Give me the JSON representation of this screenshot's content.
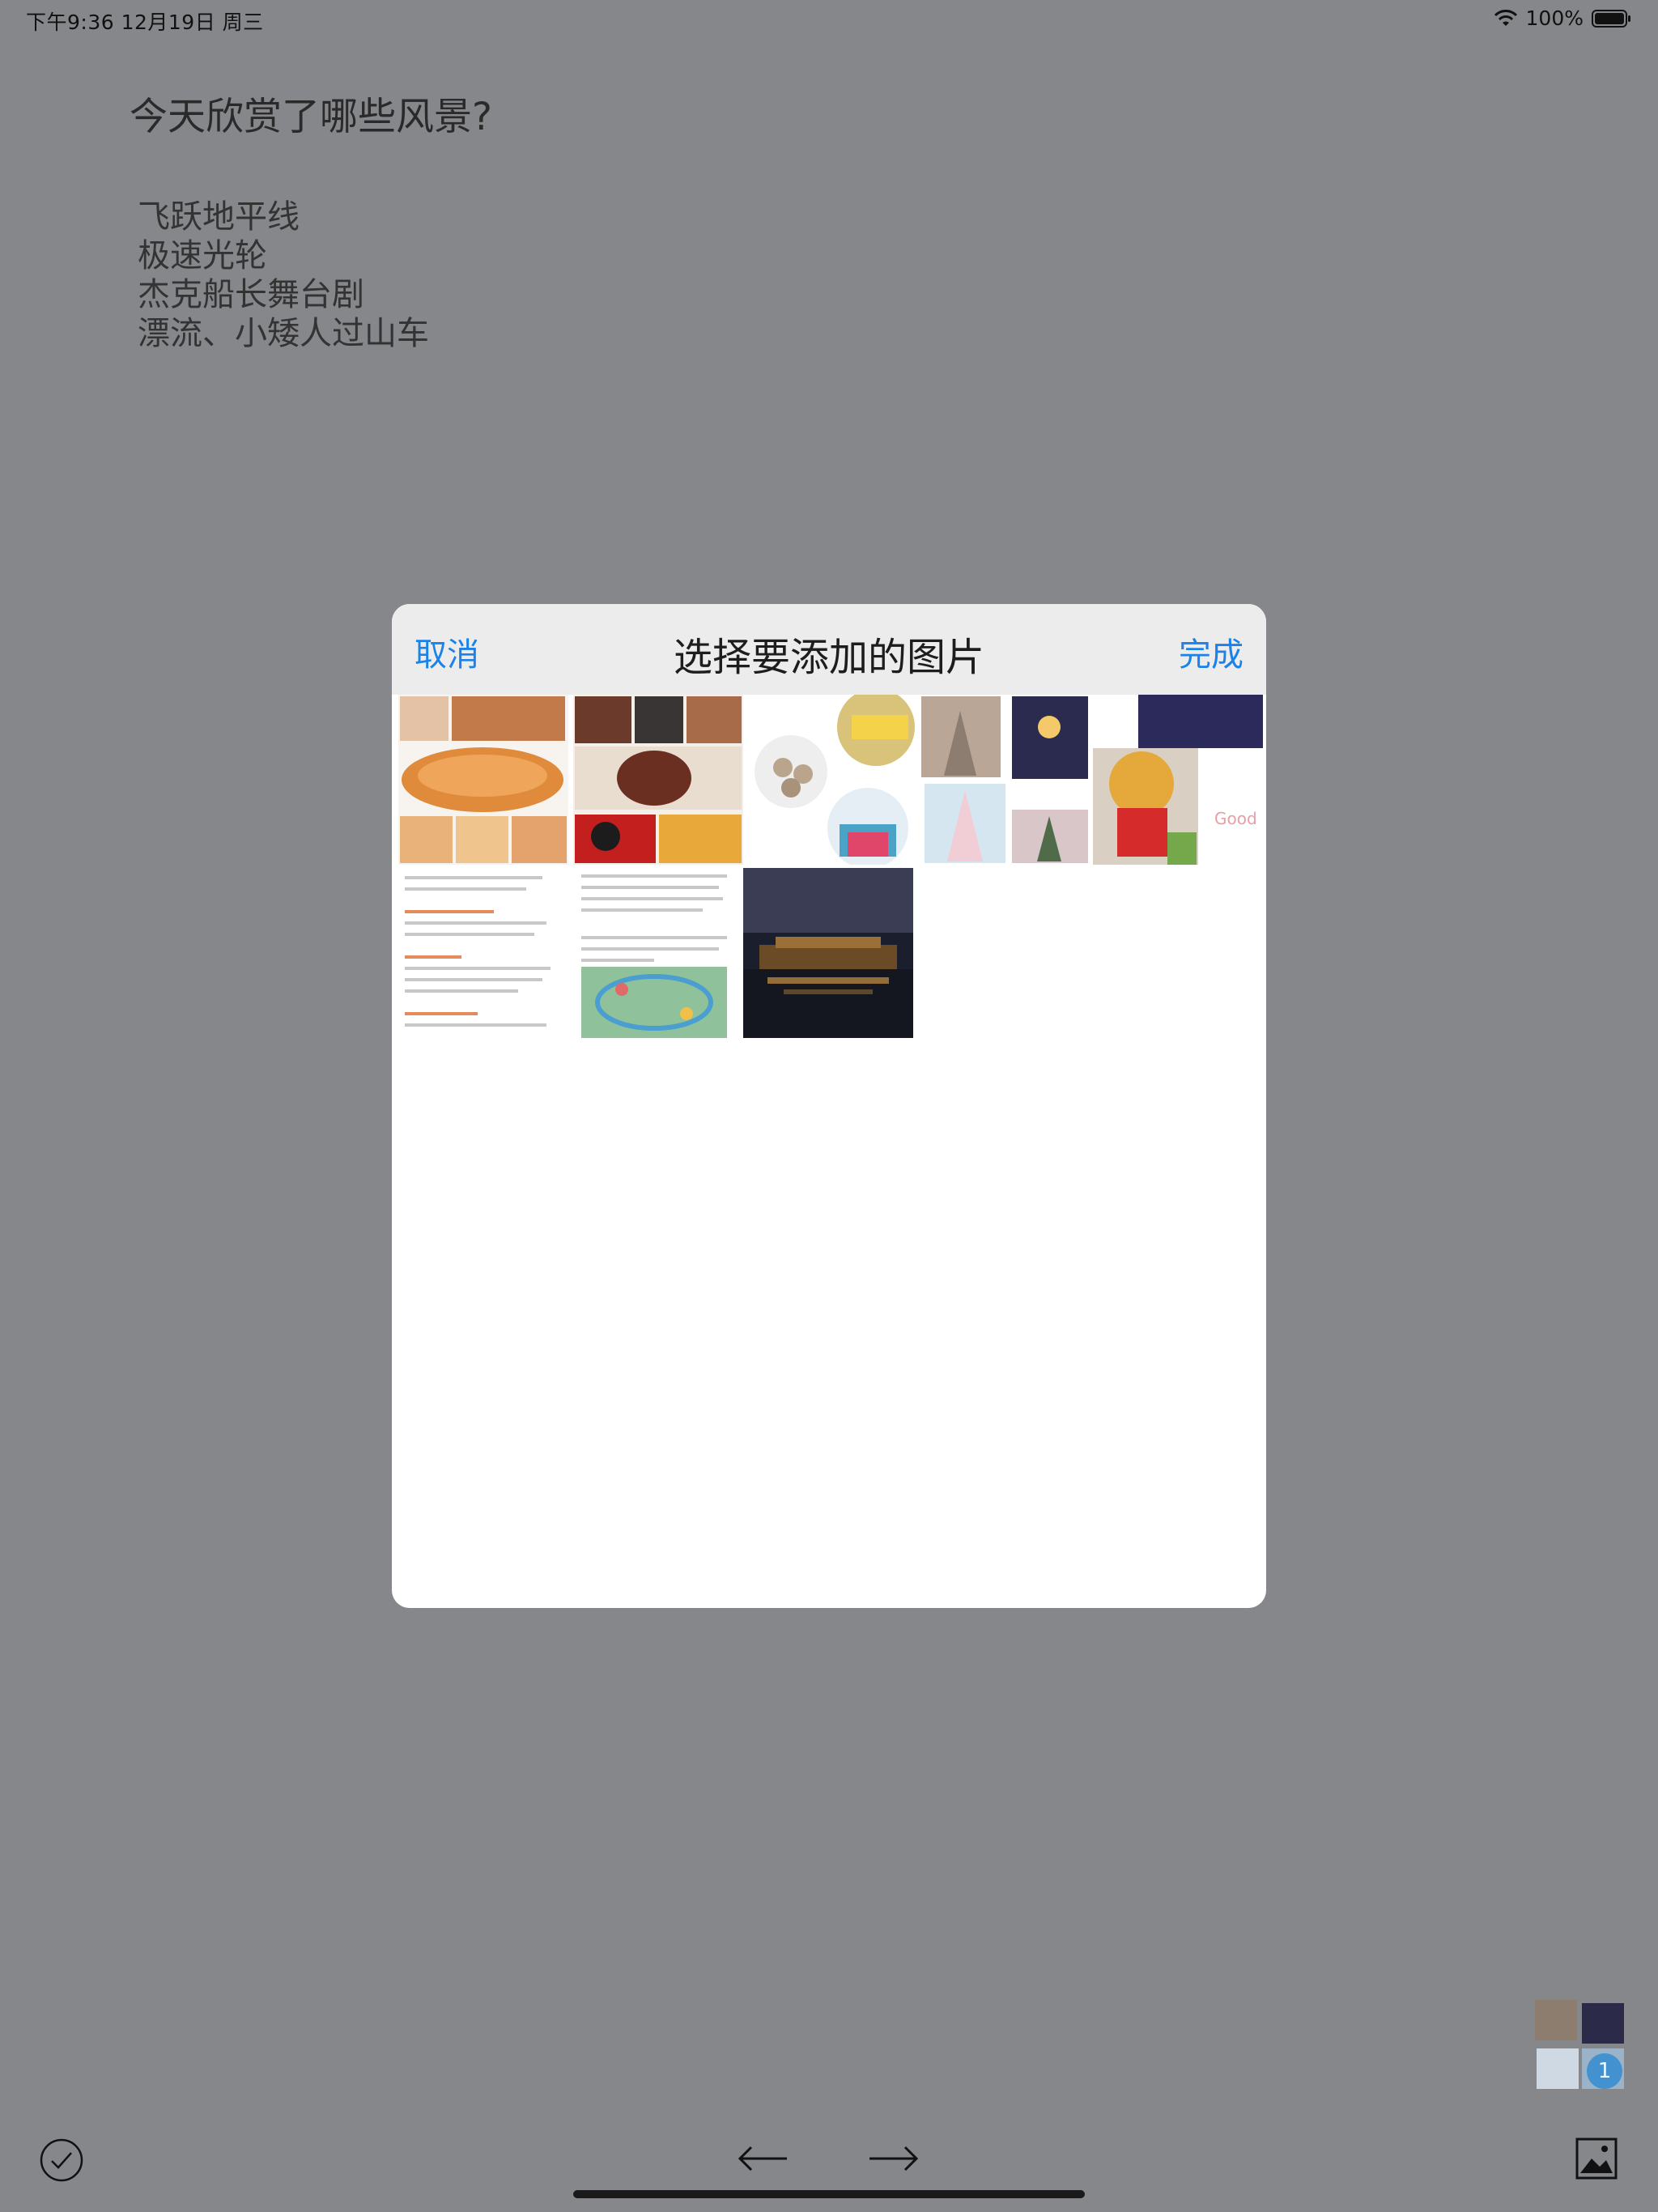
{
  "status_bar": {
    "time_date": "下午9:36   12月19日 周三",
    "battery": "100%"
  },
  "note": {
    "title": "今天欣赏了哪些风景?",
    "lines": [
      "飞跃地平线",
      "极速光轮",
      "杰克船长舞台剧",
      "漂流、小矮人过山车"
    ]
  },
  "picker": {
    "title": "选择要添加的图片",
    "cancel_label": "取消",
    "done_label": "完成"
  },
  "photos": [
    {
      "name": "photo-food-collage"
    },
    {
      "name": "photo-desserts-collage"
    },
    {
      "name": "photo-dumplings-good"
    },
    {
      "name": "photo-castle-collage"
    },
    {
      "name": "photo-pooh-collage"
    },
    {
      "name": "photo-text-notes"
    },
    {
      "name": "photo-text-map"
    },
    {
      "name": "photo-night-hotel"
    }
  ],
  "toolbar": {
    "check_icon": "checkmark-circle-icon",
    "prev_icon": "arrow-left-icon",
    "next_icon": "arrow-right-icon",
    "image_icon": "photo-icon",
    "badge_count": "1"
  },
  "colors": {
    "accent": "#1a82e8",
    "backdrop": "#86878b",
    "header": "#ececec"
  }
}
